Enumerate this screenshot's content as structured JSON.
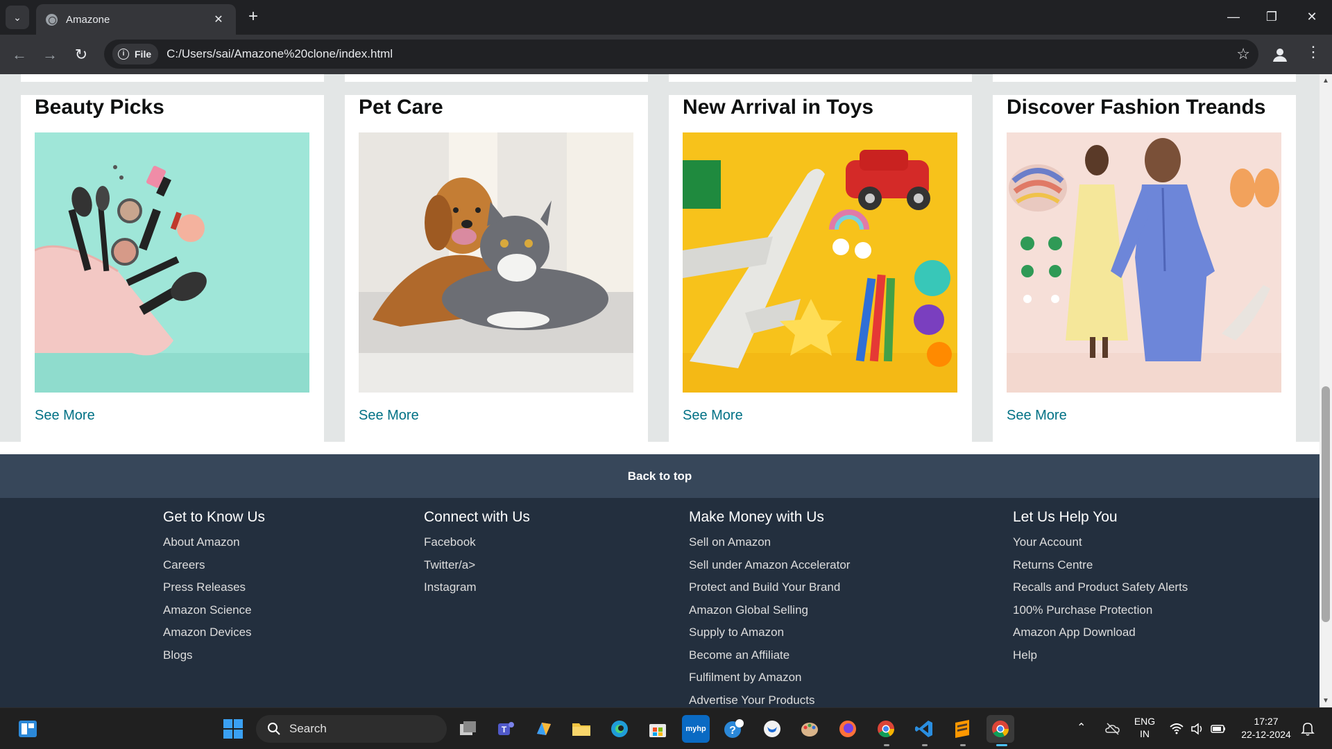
{
  "browser": {
    "tab_title": "Amazone",
    "chip_label": "File",
    "url": "C:/Users/sai/Amazone%20clone/index.html"
  },
  "cards": [
    {
      "title": "Beauty Picks",
      "link": "See More",
      "image": "makeup-cosmetics-image"
    },
    {
      "title": "Pet Care",
      "link": "See More",
      "image": "dog-and-cat-image"
    },
    {
      "title": "New Arrival in Toys",
      "link": "See More",
      "image": "toys-image"
    },
    {
      "title": "Discover Fashion Treands",
      "link": "See More",
      "image": "fashion-image"
    }
  ],
  "back_to_top": "Back to top",
  "footer": {
    "columns": [
      {
        "heading": "Get to Know Us",
        "links": [
          "About Amazon",
          "Careers",
          "Press Releases",
          "Amazon Science",
          "Amazon Devices",
          "Blogs"
        ]
      },
      {
        "heading": "Connect with Us",
        "links": [
          "Facebook",
          "Twitter/a>",
          "Instagram"
        ]
      },
      {
        "heading": "Make Money with Us",
        "links": [
          "Sell on Amazon",
          "Sell under Amazon Accelerator",
          "Protect and Build Your Brand",
          "Amazon Global Selling",
          "Supply to Amazon",
          "Become an Affiliate",
          "Fulfilment by Amazon",
          "Advertise Your Products"
        ]
      },
      {
        "heading": "Let Us Help You",
        "links": [
          "Your Account",
          "Returns Centre",
          "Recalls and Product Safety Alerts",
          "100% Purchase Protection",
          "Amazon App Download",
          "Help"
        ]
      }
    ]
  },
  "taskbar": {
    "search_label": "Search",
    "lang_line1": "ENG",
    "lang_line2": "IN",
    "time": "17:27",
    "date": "22-12-2024"
  },
  "colors": {
    "link": "#007185",
    "back_to_top_bg": "#37475a",
    "footer_bg": "#232f3e",
    "page_bg": "#e3e6e6"
  }
}
